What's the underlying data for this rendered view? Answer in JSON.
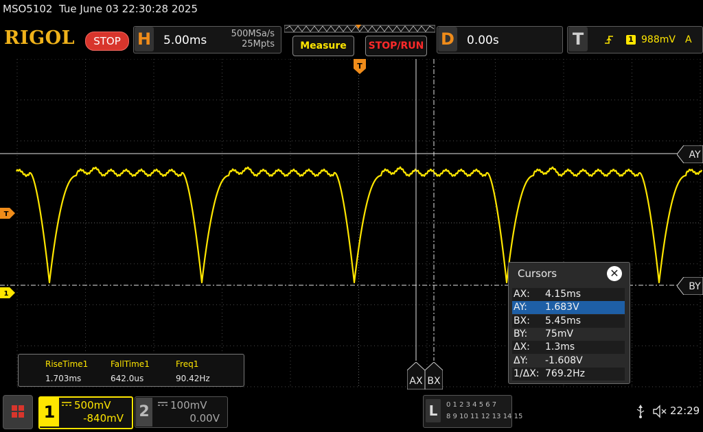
{
  "status": {
    "model": "MSO5102",
    "datetime": "Tue June 03 22:30:28 2025"
  },
  "header": {
    "brand": "RIGOL",
    "run_state": "STOP",
    "horizontal": {
      "letter": "H",
      "timebase": "5.00ms",
      "sample_rate": "500MSa/s",
      "memory_depth": "25Mpts"
    },
    "measure_label": "Measure",
    "stoprun_label": "STOP/RUN",
    "delay": {
      "letter": "D",
      "value": "0.00s"
    },
    "trigger": {
      "letter": "T",
      "source": "1",
      "level": "988mV",
      "mode": "A",
      "edge_icon": "rising-edge-icon"
    }
  },
  "screen": {
    "trigger_marker": "T",
    "channel_marker": "1",
    "cursor_labels": {
      "ay": "AY",
      "by": "BY",
      "ax": "AX",
      "bx": "BX"
    }
  },
  "cursors": {
    "title": "Cursors",
    "close_icon": "close-icon",
    "rows": [
      {
        "key": "AX:",
        "value": "4.15ms"
      },
      {
        "key": "AY:",
        "value": "1.683V"
      },
      {
        "key": "BX:",
        "value": "5.45ms"
      },
      {
        "key": "BY:",
        "value": "75mV"
      },
      {
        "key": "ΔX:",
        "value": "1.3ms"
      },
      {
        "key": "ΔY:",
        "value": "-1.608V"
      },
      {
        "key": "1/ΔX:",
        "value": "769.2Hz"
      }
    ],
    "selected_row": 1
  },
  "measurements": [
    {
      "name": "RiseTime1",
      "value": "1.703ms"
    },
    {
      "name": "FallTime1",
      "value": "642.0us"
    },
    {
      "name": "Freq1",
      "value": "90.42Hz"
    }
  ],
  "channels": {
    "ch1": {
      "number": "1",
      "scale": "500mV",
      "offset": "-840mV",
      "color": "#ffe600"
    },
    "ch2": {
      "number": "2",
      "scale": "100mV",
      "offset": "0.00V",
      "color": "#a8a8a8"
    }
  },
  "logic_analyzer": {
    "letter": "L",
    "row1": "0 1 2 3  4 5 6 7",
    "row2": "8  9 10 11  12 13 14 15"
  },
  "system_tray": {
    "usb_icon": "usb-icon",
    "speaker_icon": "speaker-muted-icon",
    "time": "22:29"
  },
  "colors": {
    "accent": "#f08c1a",
    "trace": "#ffe600",
    "stop": "#d8352c",
    "selection": "#1e5fa6"
  }
}
